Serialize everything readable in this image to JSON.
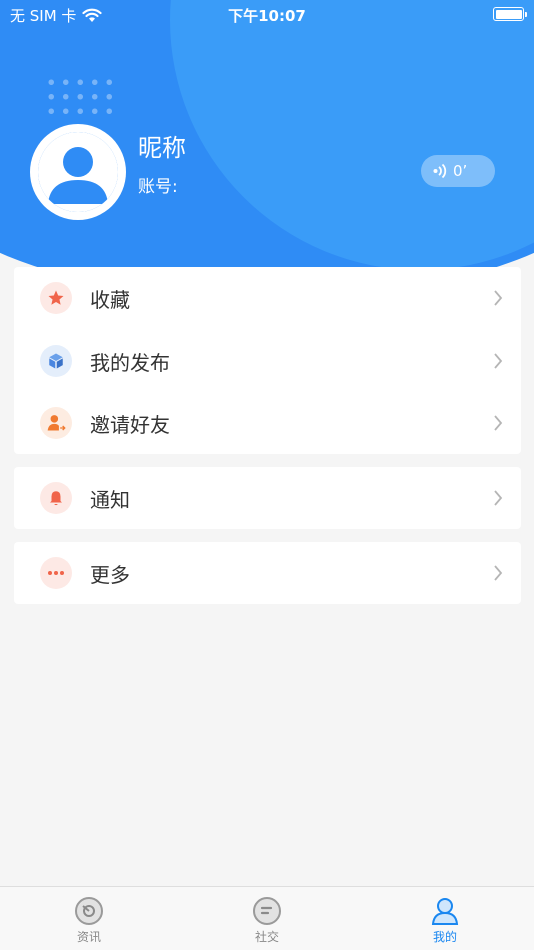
{
  "status_bar": {
    "carrier": "无 SIM 卡",
    "time": "下午10:07"
  },
  "profile": {
    "nickname": "昵称",
    "account_label": "账号:",
    "voice_badge": "0’"
  },
  "menu_groups": [
    {
      "items": [
        {
          "label": "收藏",
          "icon": "star-icon",
          "color": "#f0644a",
          "bg": "#fde9e5"
        },
        {
          "label": "我的发布",
          "icon": "box-icon",
          "color": "#4a86e0",
          "bg": "#e4eefb"
        },
        {
          "label": "邀请好友",
          "icon": "invite-user-icon",
          "color": "#f07a30",
          "bg": "#fdece1"
        }
      ]
    },
    {
      "items": [
        {
          "label": "通知",
          "icon": "bell-icon",
          "color": "#f0644a",
          "bg": "#fde9e5"
        }
      ]
    },
    {
      "items": [
        {
          "label": "更多",
          "icon": "more-dots-icon",
          "color": "#f0644a",
          "bg": "#fde9e5"
        }
      ]
    }
  ],
  "tabbar": {
    "tabs": [
      {
        "label": "资讯",
        "icon": "news-icon",
        "active": false
      },
      {
        "label": "社交",
        "icon": "chat-icon",
        "active": false
      },
      {
        "label": "我的",
        "icon": "profile-icon",
        "active": true
      }
    ]
  },
  "colors": {
    "primary": "#2f8cf5",
    "active_tab": "#1a87f0",
    "background": "#f5f5f5"
  }
}
